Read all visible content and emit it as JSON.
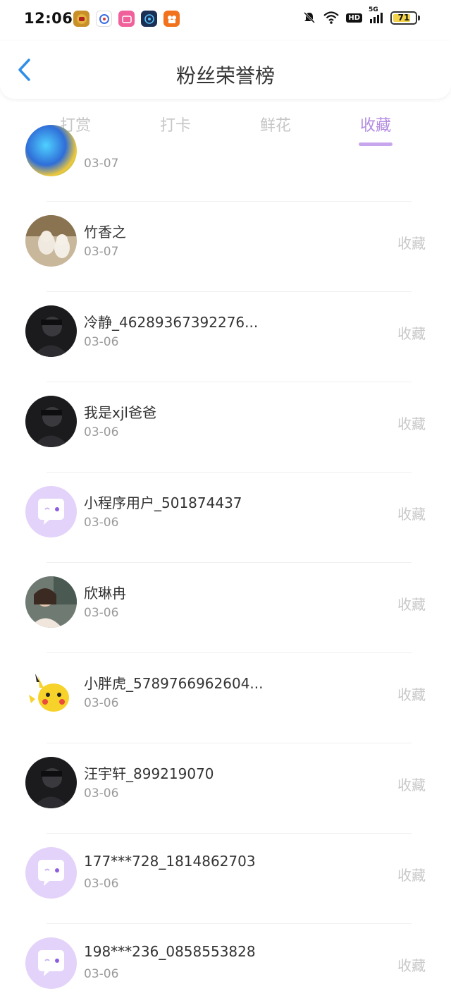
{
  "status_bar": {
    "time": "12:06",
    "app_icons": [
      {
        "name": "ironman-app-icon",
        "color": "#b8860b",
        "glyph": "⬤"
      },
      {
        "name": "baidu-app-icon",
        "color": "#3a6fe0",
        "glyph": "◎"
      },
      {
        "name": "bilibili-app-icon",
        "color": "#f0609a",
        "glyph": "▣"
      },
      {
        "name": "assistant-app-icon",
        "color": "#1c4a8a",
        "glyph": "◉"
      },
      {
        "name": "kuaishou-app-icon",
        "color": "#f2711c",
        "glyph": "▦"
      }
    ],
    "hd_label": "HD",
    "network_label": "5G",
    "battery_level": "71"
  },
  "header": {
    "title": "粉丝荣誉榜"
  },
  "tabs": [
    {
      "label": "打赏",
      "active": false
    },
    {
      "label": "打卡",
      "active": false
    },
    {
      "label": "鲜花",
      "active": false
    },
    {
      "label": "收藏",
      "active": true
    }
  ],
  "colors": {
    "accent": "#b48de0",
    "indicator": "#c8a6ee",
    "default_avatar_bg": "#e3d3fa"
  },
  "list": {
    "action_label": "收藏",
    "partial_top_date": "03-07",
    "items": [
      {
        "name": "竹香之",
        "date": "03-07",
        "avatar": "photo-cats"
      },
      {
        "name": "冷静_46289367392276...",
        "date": "03-06",
        "avatar": "photo-dark"
      },
      {
        "name": "我是xjl爸爸",
        "date": "03-06",
        "avatar": "photo-dark"
      },
      {
        "name": "小程序用户_501874437",
        "date": "03-06",
        "avatar": "default"
      },
      {
        "name": "欣琳冉",
        "date": "03-06",
        "avatar": "photo-girl"
      },
      {
        "name": "小胖虎_5789766962604...",
        "date": "03-06",
        "avatar": "pikachu"
      },
      {
        "name": "汪宇轩_899219070",
        "date": "03-06",
        "avatar": "photo-dark"
      },
      {
        "name": "177***728_1814862703",
        "date": "03-06",
        "avatar": "default"
      },
      {
        "name": "198***236_0858553828",
        "date": "03-06",
        "avatar": "default"
      }
    ]
  }
}
